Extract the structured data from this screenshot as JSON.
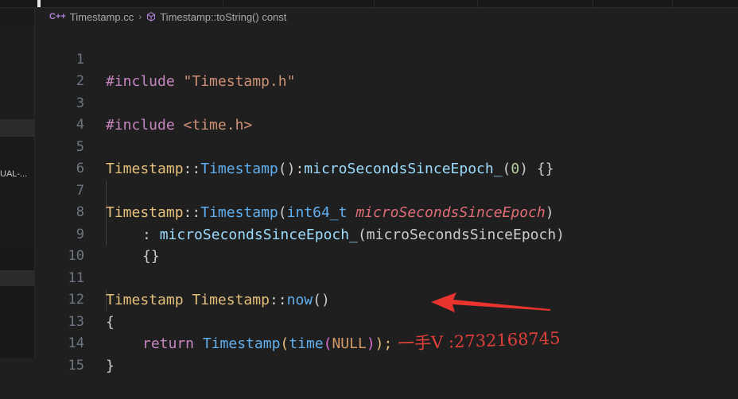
{
  "breadcrumb": {
    "file": "Timestamp.cc",
    "file_icon": "C++",
    "symbol": "Timestamp::toString() const"
  },
  "sidebar": {
    "partial_label": "UAL-..."
  },
  "editor": {
    "lines": [
      {
        "n": "1"
      },
      {
        "n": "2"
      },
      {
        "n": "3"
      },
      {
        "n": "4"
      },
      {
        "n": "5"
      },
      {
        "n": "6"
      },
      {
        "n": "7"
      },
      {
        "n": "8"
      },
      {
        "n": "9"
      },
      {
        "n": "10"
      },
      {
        "n": "11"
      },
      {
        "n": "12"
      },
      {
        "n": "13"
      },
      {
        "n": "14"
      },
      {
        "n": "15"
      }
    ],
    "tokens": {
      "l1_directive": "#include",
      "l1_file": "\"Timestamp.h\"",
      "l3_directive": "#include",
      "l3_file": "<time.h>",
      "l5_class": "Timestamp",
      "l5_scope": "::",
      "l5_ctor": "Timestamp",
      "l5_p1": "():",
      "l5_member": "microSecondsSinceEpoch_",
      "l5_p2": "(",
      "l5_num": "0",
      "l5_p3": ") {}",
      "l7_class": "Timestamp",
      "l7_scope": "::",
      "l7_ctor": "Timestamp",
      "l7_p1": "(",
      "l7_type": "int64_t",
      "l7_param": "microSecondsSinceEpoch",
      "l7_p2": ")",
      "l8_colon": ": ",
      "l8_member": "microSecondsSinceEpoch_",
      "l8_p1": "(microSecondsSinceEpoch)",
      "l9_braces": "{}",
      "l11_class": "Timestamp",
      "l11_class2": "Timestamp",
      "l11_scope": "::",
      "l11_fn": "now",
      "l11_p": "()",
      "l12_brace": "{",
      "l13_kw": "return",
      "l13_class": "Timestamp",
      "l13_p1": "(",
      "l13_fn": "time",
      "l13_p2": "(",
      "l13_null": "NULL",
      "l13_p3": ")",
      "l13_p4": ");",
      "l14_brace": "}"
    }
  },
  "annotation": {
    "watermark": "一手V :2732168745",
    "arrow_color": "#e8332f"
  }
}
